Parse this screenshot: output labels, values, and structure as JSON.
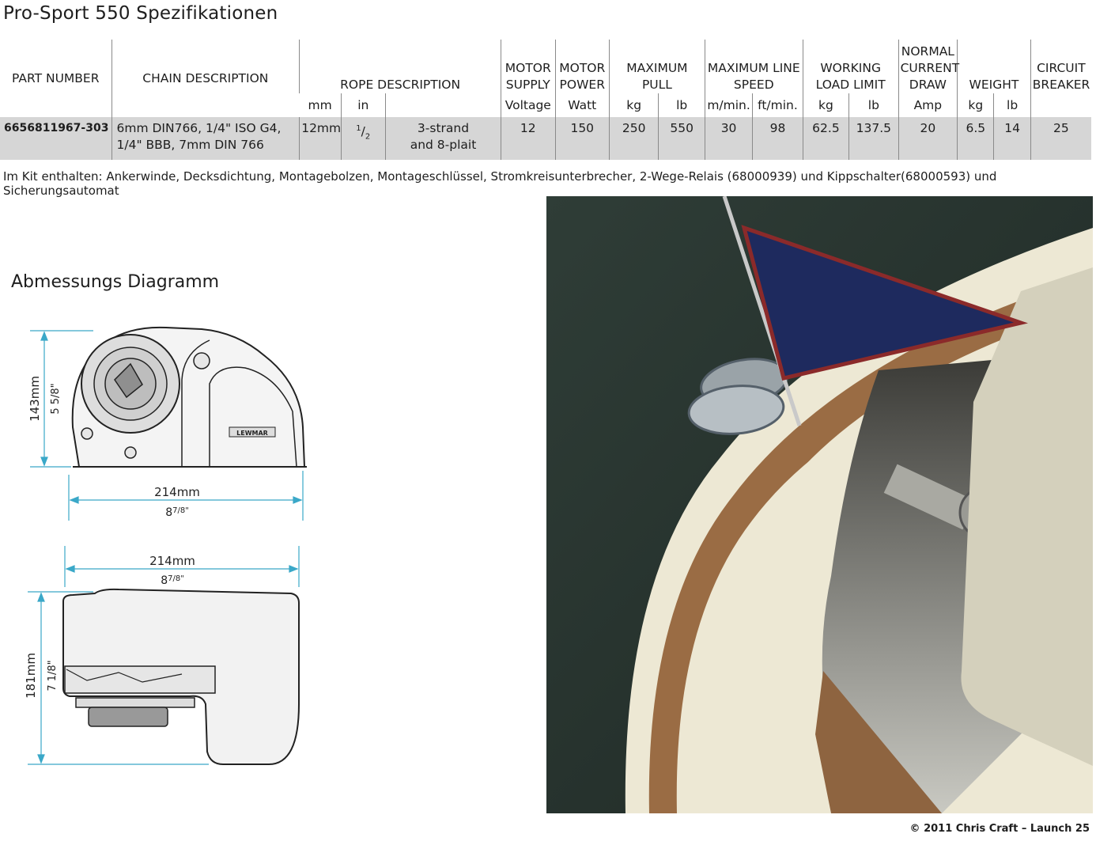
{
  "page": {
    "title": "Pro-Sport 550 Spezifikationen",
    "kit_note": "Im Kit enthalten: Ankerwinde, Decksdichtung, Montagebolzen, Montageschlüssel, Stromkreisunterbrecher, 2-Wege-Relais (68000939) und Kippschalter(68000593) und Sicherungsautomat",
    "diagram_title": "Abmessungs Diagramm",
    "credit": "© 2011 Chris Craft – Launch 25"
  },
  "table": {
    "headers": {
      "part_number": "PART NUMBER",
      "chain_description": "CHAIN DESCRIPTION",
      "rope_description": "ROPE DESCRIPTION",
      "motor_supply": "MOTOR SUPPLY",
      "motor_power": "MOTOR POWER",
      "maximum_pull": "MAXIMUM PULL",
      "maximum_line_speed": "MAXIMUM LINE SPEED",
      "working_load_limit": "WORKING LOAD LIMIT",
      "normal_current_draw": "NORMAL CURRENT DRAW",
      "weight": "WEIGHT",
      "circuit_breaker": "CIRCUIT BREAKER"
    },
    "units": {
      "rope_mm": "mm",
      "rope_in": "in",
      "supply": "Voltage",
      "power": "Watt",
      "pull_kg": "kg",
      "pull_lb": "lb",
      "speed_m": "m/min.",
      "speed_ft": "ft/min.",
      "wll_kg": "kg",
      "wll_lb": "lb",
      "current": "Amp",
      "weight_kg": "kg",
      "weight_lb": "lb"
    },
    "row": {
      "part_number": "6656811967-303",
      "chain_description": "6mm DIN766, 1/4\" ISO G4, 1/4\" BBB, 7mm DIN 766",
      "rope_mm": "12mm",
      "rope_in_num": "1",
      "rope_in_den": "2",
      "rope_type_1": "3-strand",
      "rope_type_2": "and 8-plait",
      "supply": "12",
      "power": "150",
      "pull_kg": "250",
      "pull_lb": "550",
      "speed_m": "30",
      "speed_ft": "98",
      "wll_kg": "62.5",
      "wll_lb": "137.5",
      "current": "20",
      "weight_kg": "6.5",
      "weight_lb": "14",
      "breaker": "25"
    }
  },
  "diagram": {
    "top_height_mm": "143mm",
    "top_height_in": "5 5/8\"",
    "top_width_mm": "214mm",
    "top_width_in": "8",
    "top_width_in_frac": "7/8\"",
    "brand": "LEWMAR",
    "side_width_mm": "214mm",
    "side_width_in": "8",
    "side_width_in_frac": "7/8\"",
    "side_height_mm": "181mm",
    "side_height_in": "7 1/8\""
  },
  "colors": {
    "dimension_line": "#3aa8c8",
    "row_bg": "#d6d6d6",
    "water": "#2b3a34",
    "hull": "#ece7d2",
    "teak": "#9a6c44"
  }
}
